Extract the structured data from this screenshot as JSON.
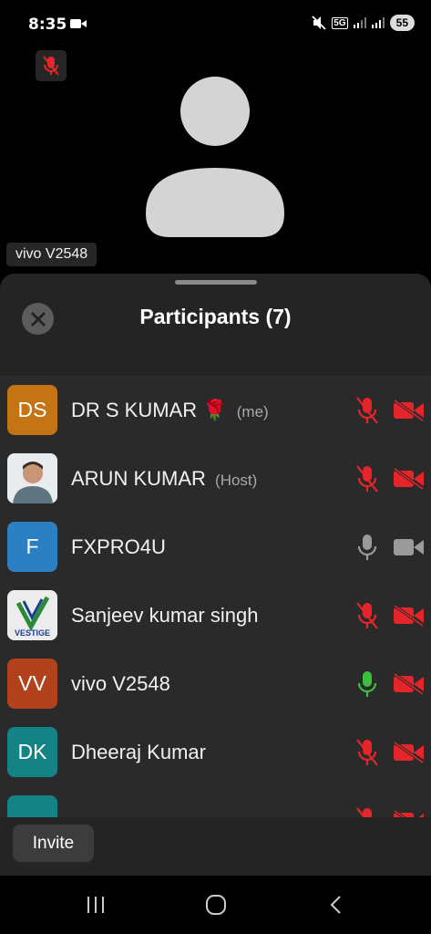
{
  "status_bar": {
    "time": "8:35",
    "network": "5G",
    "battery": "55"
  },
  "video": {
    "name_tag": "vivo V2548"
  },
  "sheet": {
    "title": "Participants (7)",
    "participants": [
      {
        "initials": "DS",
        "name": "DR S KUMAR 🌹",
        "role": "(me)",
        "avatar_color": "#c57414",
        "mic": "muted",
        "camera": "off"
      },
      {
        "initials": "",
        "name": "ARUN KUMAR",
        "role": "(Host)",
        "avatar_color": "#d9d9d9",
        "mic": "muted",
        "camera": "off"
      },
      {
        "initials": "F",
        "name": "FXPRO4U",
        "role": "",
        "avatar_color": "#2b7fc3",
        "mic": "on",
        "camera": "on"
      },
      {
        "initials": "",
        "name": "Sanjeev kumar singh",
        "role": "",
        "avatar_color": "#e8e8e8",
        "mic": "muted",
        "camera": "off",
        "avatar_logo_text": "VESTIGE"
      },
      {
        "initials": "VV",
        "name": "vivo V2548",
        "role": "",
        "avatar_color": "#b2421b",
        "mic": "speaking",
        "camera": "off"
      },
      {
        "initials": "DK",
        "name": "Dheeraj Kumar",
        "role": "",
        "avatar_color": "#138385",
        "mic": "muted",
        "camera": "off"
      },
      {
        "initials": "",
        "name": "",
        "role": "",
        "avatar_color": "#138385",
        "mic": "muted",
        "camera": "off"
      }
    ],
    "invite_label": "Invite"
  },
  "colors": {
    "muted_red": "#e5252a",
    "speaking_green": "#3cbf3c",
    "neutral_icon": "#9a9a9a"
  }
}
